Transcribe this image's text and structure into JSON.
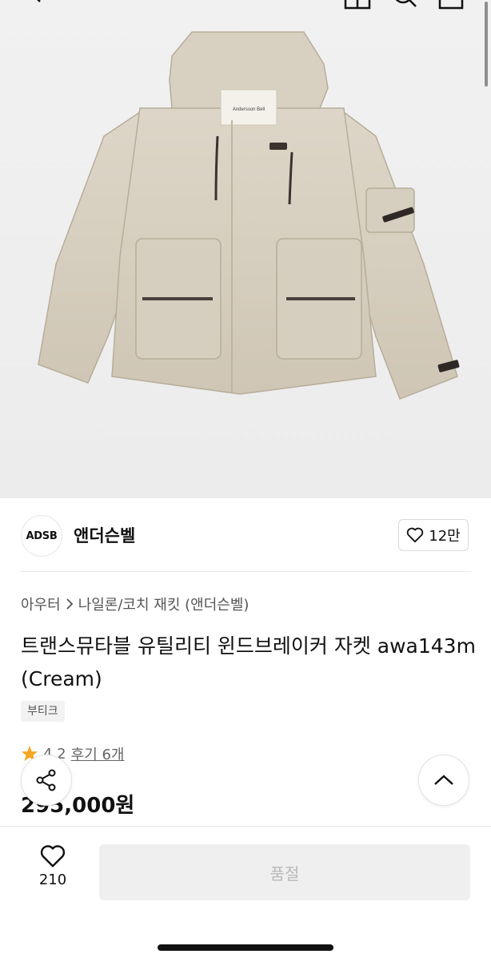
{
  "brand": {
    "avatar_text": "ADSB",
    "name": "앤더슨벨",
    "like_count": "12만"
  },
  "product": {
    "garment_label": "Andersson Bell",
    "breadcrumb": {
      "category": "아우터",
      "subcategory": "나일론/코치 재킷 (앤더슨벨)"
    },
    "title": "트랜스뮤타블 유틸리티 윈드브레이커 자켓 awa143m(Cream)",
    "badge": "부티크",
    "rating": "4.2",
    "review_link": "후기 6개",
    "price": "295,000원"
  },
  "actions": {
    "wish_count": "210",
    "buy_button_label": "품절"
  },
  "icons": {
    "back": "chevron-left-icon",
    "cart": "shopping-bag-icon",
    "search": "search-icon",
    "menu": "menu-icon",
    "like": "heart-icon",
    "star": "star-icon",
    "share": "share-icon",
    "scroll_top": "chevron-up-icon"
  },
  "colors": {
    "star": "#f5a623",
    "soldout_bg": "#efefef",
    "soldout_text": "#b9b9b9"
  }
}
